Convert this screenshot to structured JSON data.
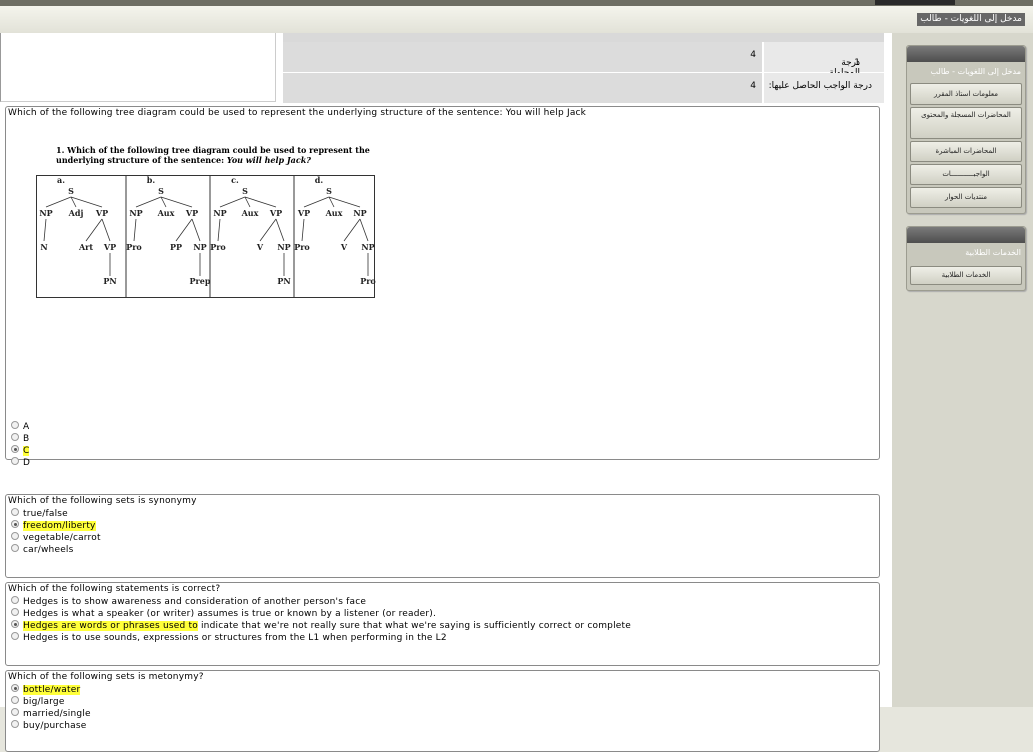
{
  "header": {
    "page_title": "مدخل إلى اللغويات - طالب"
  },
  "attempt": {
    "row1_label": "درجة المحاولة :",
    "row1_value": "4",
    "row1_num": "1",
    "row2_label": "درجة الواجب الحاصل عليها:",
    "row2_value": "4"
  },
  "questions": [
    {
      "text": "Which of the following tree diagram could be used to represent the underlying structure of the sentence: You will help Jack",
      "image_question": "1.  Which of the following tree diagram could be used to represent the underlying structure of the sentence:",
      "image_question_line2": "underlying structure of the sentence:",
      "image_sentence": "You will help Jack?",
      "options": [
        "A",
        "B",
        "C",
        "D"
      ],
      "selected": 2
    },
    {
      "text": "Which of the following sets is synonymy",
      "options": [
        "true/false",
        "freedom/liberty",
        "vegetable/carrot",
        "car/wheels"
      ],
      "selected": 1
    },
    {
      "text": "Which of the following statements is correct?",
      "options": [
        "Hedges is to show awareness and consideration of another person's face",
        "Hedges is what a speaker (or writer) assumes is true or known by a listener (or reader).",
        "Hedges are words or phrases used to indicate that we're not really sure that what we're saying is sufficiently correct or complete",
        "Hedges is to use sounds, expressions or structures from the L1 when performing in the L2"
      ],
      "selected": 2,
      "highlight_part": "Hedges are words or phrases used to",
      "rest_part": "indicate that we're not really sure that what we're saying is sufficiently correct or complete"
    },
    {
      "text": "Which of the following sets is metonymy?",
      "options": [
        "bottle/water",
        "big/large",
        "married/single",
        "buy/purchase"
      ],
      "selected": 0
    }
  ],
  "diagram": {
    "labels": [
      "a.",
      "b.",
      "c.",
      "d."
    ],
    "trees": [
      {
        "top": "S",
        "mid": [
          "NP",
          "Adj",
          "VP"
        ],
        "low": [
          "N",
          "Art",
          "VP"
        ],
        "bottom": "PN"
      },
      {
        "top": "S",
        "mid": [
          "NP",
          "Aux",
          "VP"
        ],
        "low": [
          "Pro",
          "PP",
          "NP"
        ],
        "bottom": "Prep"
      },
      {
        "top": "S",
        "mid": [
          "NP",
          "Aux",
          "VP"
        ],
        "low": [
          "Pro",
          "V",
          "NP"
        ],
        "bottom": "PN"
      },
      {
        "top": "S",
        "mid": [
          "VP",
          "Aux",
          "NP"
        ],
        "low": [
          "Pro",
          "V",
          "NP"
        ],
        "bottom": "Pro"
      }
    ]
  },
  "sidebar": {
    "panel1_title": "مدخل إلى اللغويات - طالب",
    "items": [
      "معلومات استاذ المقرر",
      "المحاضرات المسجلة والمحتوى",
      "المحاضرات المباشرة",
      "الواجبـــــــــــات",
      "منتديات الحوار"
    ],
    "panel2_title": "الخدمات الطلابية",
    "panel2_items": [
      "الخدمات الطلابية"
    ]
  }
}
